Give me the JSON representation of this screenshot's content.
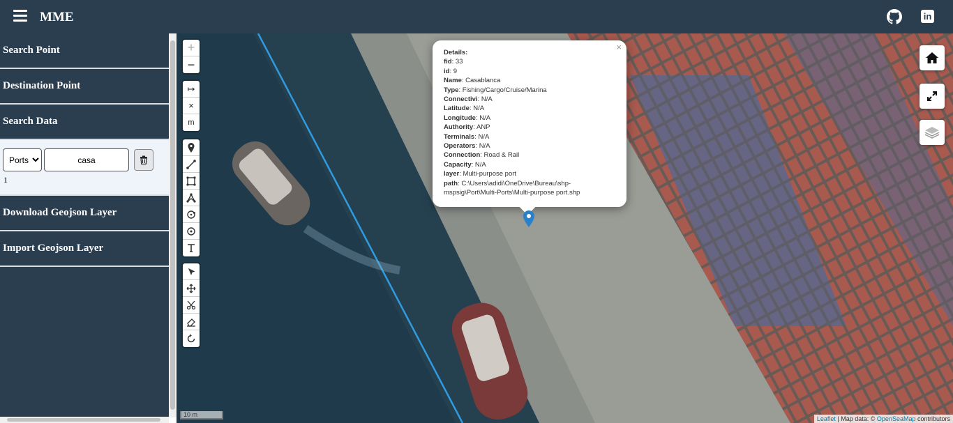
{
  "header": {
    "title": "MME",
    "menu_icon": "hamburger-icon",
    "github_icon": "github-icon",
    "linkedin_icon": "linkedin-icon",
    "linkedin_glyph": "in"
  },
  "sidebar": {
    "items": [
      {
        "label": "Search Point"
      },
      {
        "label": "Destination Point"
      },
      {
        "label": "Search Data"
      }
    ],
    "search": {
      "layer_select_value": "Ports",
      "layer_options": [
        "Ports"
      ],
      "query_value": "casa",
      "result_count": "1"
    },
    "items_after": [
      {
        "label": "Download Geojson Layer"
      },
      {
        "label": "Import Geojson Layer"
      }
    ]
  },
  "map": {
    "zoom_in": "+",
    "zoom_out": "−",
    "measure_tools": [
      "↦",
      "×",
      "m"
    ],
    "draw_tools": [
      "marker-icon",
      "polyline-icon",
      "rectangle-icon",
      "polygon-icon",
      "circle-icon",
      "circlemarker-icon",
      "text-icon"
    ],
    "edit_tools": [
      "cut-icon",
      "drag-icon",
      "scissors-icon",
      "eraser-icon",
      "rotate-icon"
    ],
    "popup": {
      "close": "×",
      "heading": "Details:",
      "fields": [
        {
          "key": "fid",
          "value": "33"
        },
        {
          "key": "id",
          "value": "9"
        },
        {
          "key": "Name",
          "value": "Casablanca"
        },
        {
          "key": "Type",
          "value": "Fishing/Cargo/Cruise/Marina"
        },
        {
          "key": "Connectivi",
          "value": "N/A"
        },
        {
          "key": "Latitude",
          "value": "N/A"
        },
        {
          "key": "Longitude",
          "value": "N/A"
        },
        {
          "key": "Authority",
          "value": "ANP"
        },
        {
          "key": "Terminals",
          "value": "N/A"
        },
        {
          "key": "Operators",
          "value": "N/A"
        },
        {
          "key": "Connection",
          "value": "Road & Rail"
        },
        {
          "key": "Capacity",
          "value": "N/A"
        },
        {
          "key": "layer",
          "value": "Multi-purpose port"
        },
        {
          "key": "path",
          "value": "C:\\Users\\adidi\\OneDrive\\Bureau\\shp-mspsig\\Port\\Multi-Ports\\Multi-purpose port.shp"
        }
      ]
    },
    "scale": "10 m",
    "attribution": {
      "leaflet": "Leaflet",
      "sep": " | Map data: © ",
      "osm": "OpenSeaMap",
      "tail": " contributors"
    }
  }
}
